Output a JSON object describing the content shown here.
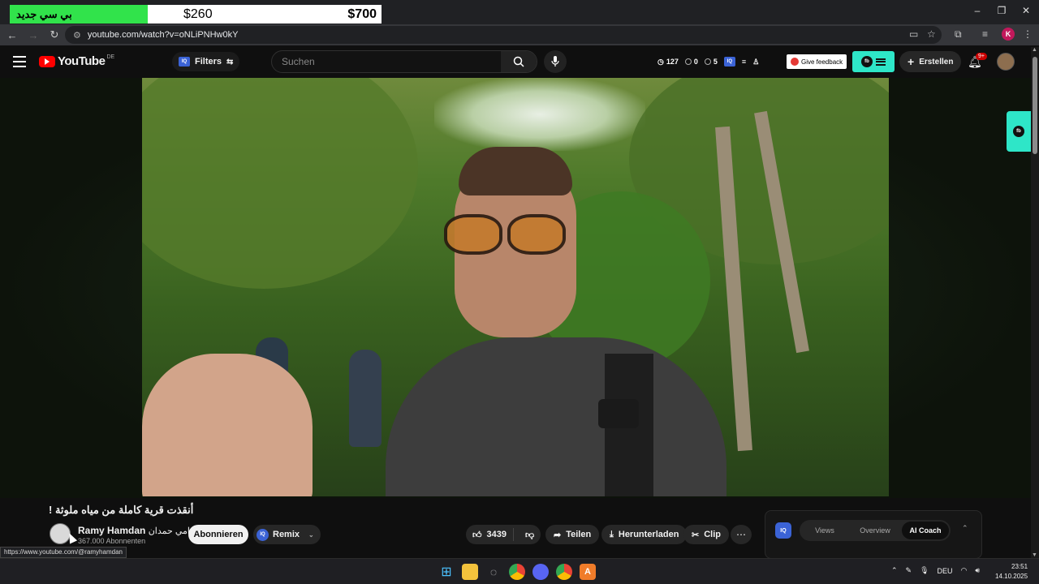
{
  "banner": {
    "arabic_label": "بي سي جديد",
    "price_1": "$260",
    "price_2": "$700"
  },
  "window_controls": {
    "minimize": "–",
    "restore": "❐",
    "close": "✕"
  },
  "browser": {
    "url": "youtube.com/watch?v=oNLiPNHw0kY",
    "profile_initial": "K"
  },
  "yt": {
    "logo_text": "YouTube",
    "region": "DE",
    "filters_label": "Filters",
    "iq_label": "IQ",
    "search_placeholder": "Suchen",
    "stats": {
      "views": "127",
      "eye": "0",
      "other": "5"
    },
    "feedback_label": "Give feedback",
    "fb_label": "fb",
    "create_label": "Erstellen",
    "notif_badge": "9+"
  },
  "video": {
    "title": "أنقذت قرية كاملة من مياه ملوثة !",
    "channel_name": "Ramy Hamdan",
    "channel_name_ar": "- رامي حمدان",
    "subscribers": "367.000 Abonnenten",
    "subscribe_label": "Abonnieren",
    "remix_label": "Remix",
    "likes": "3439",
    "share_label": "Teilen",
    "download_label": "Herunterladen",
    "clip_label": "Clip",
    "more_label": "⋯"
  },
  "extension": {
    "iq_label": "IQ",
    "tabs": [
      "Views",
      "Overview",
      "AI Coach"
    ],
    "active_tab": "AI Coach"
  },
  "status_url": "https://www.youtube.com/@ramyhamdan",
  "taskbar": {
    "language": "DEU",
    "time": "23:51",
    "date": "14.10.2025"
  }
}
